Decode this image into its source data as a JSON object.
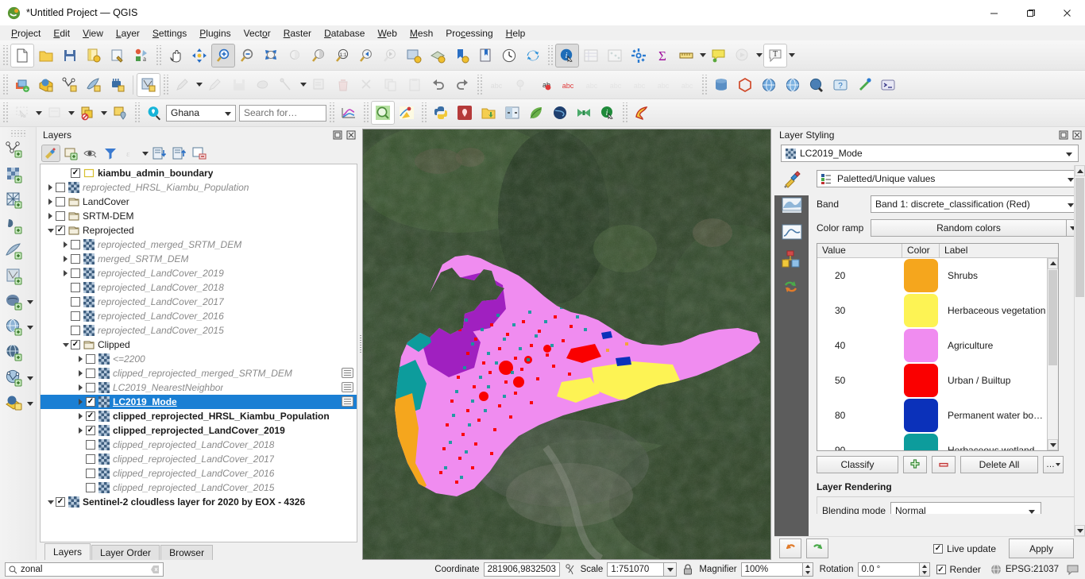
{
  "window": {
    "title": "*Untitled Project — QGIS",
    "app_icon": "qgis-logo-icon",
    "minimize": "—",
    "maximize": "❐",
    "close": "✕"
  },
  "menubar": {
    "items": [
      {
        "label": "Project",
        "mnemonic": "P"
      },
      {
        "label": "Edit",
        "mnemonic": "E"
      },
      {
        "label": "View",
        "mnemonic": "V"
      },
      {
        "label": "Layer",
        "mnemonic": "L"
      },
      {
        "label": "Settings",
        "mnemonic": "S"
      },
      {
        "label": "Plugins",
        "mnemonic": "P"
      },
      {
        "label": "Vector",
        "mnemonic": "o"
      },
      {
        "label": "Raster",
        "mnemonic": "R"
      },
      {
        "label": "Database",
        "mnemonic": "D"
      },
      {
        "label": "Web",
        "mnemonic": "W"
      },
      {
        "label": "Mesh",
        "mnemonic": "M"
      },
      {
        "label": "Processing",
        "mnemonic": "c"
      },
      {
        "label": "Help",
        "mnemonic": "H"
      }
    ]
  },
  "toolbars": {
    "project": [
      "new-project-icon",
      "open-project-icon",
      "save-project-icon",
      "save-project-as-icon",
      "new-print-layout-icon",
      "style-manager-icon"
    ],
    "navigation": [
      "pan-map-icon",
      "pan-to-selection-icon",
      "zoom-in-icon",
      "zoom-out-icon",
      "zoom-full-icon",
      "zoom-to-selection-icon",
      "zoom-to-layer-icon",
      "zoom-native-icon",
      "zoom-last-icon",
      "zoom-next-icon",
      "new-map-view-icon",
      "new-3d-map-view-icon",
      "bookmark-add-icon",
      "show-bookmarks-icon",
      "temporal-controller-icon",
      "refresh-icon"
    ],
    "attributes": [
      "identify-features-icon",
      "open-attribute-table-icon",
      "field-calculator-icon",
      "processing-toolbox-icon",
      "statistical-summary-icon",
      "measure-line-icon",
      "map-tips-icon",
      "run-feature-action-icon",
      "new-text-annotation-icon"
    ],
    "data_source": [
      "add-layer-icon",
      "add-wms-layer-icon",
      "add-vector-layer-icon",
      "add-delimited-text-layer-icon",
      "add-raster-layer-icon",
      "new-shapefile-layer-icon"
    ],
    "digitizing": [
      "current-edits-icon",
      "toggle-editing-icon",
      "save-layer-edits-icon",
      "add-polygon-feature-icon",
      "vertex-tool-icon",
      "modify-attributes-icon",
      "delete-selected-icon",
      "cut-features-icon",
      "copy-features-icon",
      "paste-features-icon",
      "undo-icon",
      "redo-icon"
    ],
    "labeling": [
      "label-icon",
      "pin-labels-icon",
      "highlight-labels-icon",
      "change-label-icon",
      "move-label-icon",
      "rotate-label-icon",
      "change-label-properties-icon",
      "show-hide-labels-icon",
      "show-unplaced-labels-icon"
    ],
    "database_web": [
      "db-manager-icon",
      "geopackage-icon",
      "metasearch-icon",
      "metasearch2-icon",
      "globe-icon",
      "help-icon",
      "plugin-manager-icon",
      "python-console-icon"
    ],
    "selection": [
      "select-features-icon",
      "deselect-icon",
      "select-by-expression-icon",
      "select-by-location-icon"
    ],
    "plugins": [
      "plugin-profile-tool-icon",
      "zoom-last-plugin-icon",
      "qgis2web-icon",
      "python-icon",
      "georeferencer-icon",
      "open-project-plugin-icon",
      "swipe-tool-icon",
      "leaflet-icon",
      "globe-plugin-icon",
      "bowtie-icon",
      "info-plugin-icon",
      "freehand-icon"
    ],
    "annotation": [
      "map-tip-icon",
      "annotation-layer-icon",
      "text-annotation-icon"
    ]
  },
  "project_selector": {
    "value": "Ghana",
    "search_placeholder": "Search for…"
  },
  "left_toolbar": {
    "items": [
      "add-vector-layer-icon",
      "add-raster-layer-icon",
      "add-mesh-layer-icon",
      "add-delimited-text-layer-icon",
      "add-spatialite-layer-icon",
      "add-vector-tile-layer-icon",
      "add-postgis-layer-icon",
      "add-wms-layer-icon",
      "add-wfs-layer-icon",
      "add-arcgis-layer-icon",
      "add-xyz-layer-icon"
    ]
  },
  "layers_panel": {
    "title": "Layers",
    "toolbar": [
      "open-layer-styling-icon",
      "add-group-icon",
      "manage-map-themes-icon",
      "filter-legend-icon",
      "filter-legend-expression-icon",
      "expand-all-icon",
      "collapse-all-icon",
      "remove-layer-icon"
    ],
    "tabs": [
      {
        "label": "Layers",
        "active": true
      },
      {
        "label": "Layer Order",
        "active": false
      },
      {
        "label": "Browser",
        "active": false
      }
    ],
    "tree": [
      {
        "label": "kiambu_admin_boundary",
        "indent": 1,
        "checked": true,
        "expander": "none",
        "icon": "polygon-layer-icon",
        "style": "bold",
        "selected": false,
        "chip": false
      },
      {
        "label": "reprojected_HRSL_Kiambu_Population",
        "indent": 0,
        "checked": false,
        "expander": "right",
        "icon": "raster-layer-icon",
        "style": "italic-grey",
        "selected": false,
        "chip": false
      },
      {
        "label": "LandCover",
        "indent": 0,
        "checked": false,
        "expander": "right",
        "icon": "group-icon",
        "style": "normal",
        "selected": false,
        "chip": false
      },
      {
        "label": "SRTM-DEM",
        "indent": 0,
        "checked": false,
        "expander": "right",
        "icon": "group-icon",
        "style": "normal",
        "selected": false,
        "chip": false
      },
      {
        "label": "Reprojected",
        "indent": 0,
        "checked": true,
        "expander": "down",
        "icon": "group-icon",
        "style": "normal",
        "selected": false,
        "chip": false
      },
      {
        "label": "reprojected_merged_SRTM_DEM",
        "indent": 1,
        "checked": false,
        "expander": "right",
        "icon": "raster-layer-icon",
        "style": "italic-grey",
        "selected": false,
        "chip": false
      },
      {
        "label": "merged_SRTM_DEM",
        "indent": 1,
        "checked": false,
        "expander": "right",
        "icon": "raster-layer-icon",
        "style": "italic-grey",
        "selected": false,
        "chip": false
      },
      {
        "label": "reprojected_LandCover_2019",
        "indent": 1,
        "checked": false,
        "expander": "right",
        "icon": "raster-layer-icon",
        "style": "italic-grey",
        "selected": false,
        "chip": false
      },
      {
        "label": "reprojected_LandCover_2018",
        "indent": 1,
        "checked": false,
        "expander": "none",
        "icon": "raster-layer-icon",
        "style": "italic-grey",
        "selected": false,
        "chip": false
      },
      {
        "label": "reprojected_LandCover_2017",
        "indent": 1,
        "checked": false,
        "expander": "none",
        "icon": "raster-layer-icon",
        "style": "italic-grey",
        "selected": false,
        "chip": false
      },
      {
        "label": "reprojected_LandCover_2016",
        "indent": 1,
        "checked": false,
        "expander": "none",
        "icon": "raster-layer-icon",
        "style": "italic-grey",
        "selected": false,
        "chip": false
      },
      {
        "label": "reprojected_LandCover_2015",
        "indent": 1,
        "checked": false,
        "expander": "none",
        "icon": "raster-layer-icon",
        "style": "italic-grey",
        "selected": false,
        "chip": false
      },
      {
        "label": "Clipped",
        "indent": 1,
        "checked": true,
        "expander": "down",
        "icon": "group-icon",
        "style": "normal",
        "selected": false,
        "chip": false
      },
      {
        "label": "<=2200",
        "indent": 2,
        "checked": false,
        "expander": "right",
        "icon": "raster-layer-icon",
        "style": "italic-grey",
        "selected": false,
        "chip": false
      },
      {
        "label": "clipped_reprojected_merged_SRTM_DEM",
        "indent": 2,
        "checked": false,
        "expander": "right",
        "icon": "raster-layer-icon",
        "style": "italic-grey",
        "selected": false,
        "chip": true
      },
      {
        "label": "LC2019_NearestNeighbor",
        "indent": 2,
        "checked": false,
        "expander": "right",
        "icon": "raster-layer-icon",
        "style": "italic-grey",
        "selected": false,
        "chip": true
      },
      {
        "label": "LC2019_Mode",
        "indent": 2,
        "checked": true,
        "expander": "right",
        "icon": "raster-layer-icon",
        "style": "selected",
        "selected": true,
        "chip": true
      },
      {
        "label": "clipped_reprojected_HRSL_Kiambu_Population",
        "indent": 2,
        "checked": true,
        "expander": "right",
        "icon": "raster-layer-icon",
        "style": "bold",
        "selected": false,
        "chip": false
      },
      {
        "label": "clipped_reprojected_LandCover_2019",
        "indent": 2,
        "checked": true,
        "expander": "right",
        "icon": "raster-layer-icon",
        "style": "bold",
        "selected": false,
        "chip": false
      },
      {
        "label": "clipped_reprojected_LandCover_2018",
        "indent": 2,
        "checked": false,
        "expander": "none",
        "icon": "raster-layer-icon",
        "style": "italic-grey",
        "selected": false,
        "chip": false
      },
      {
        "label": "clipped_reprojected_LandCover_2017",
        "indent": 2,
        "checked": false,
        "expander": "none",
        "icon": "raster-layer-icon",
        "style": "italic-grey",
        "selected": false,
        "chip": false
      },
      {
        "label": "clipped_reprojected_LandCover_2016",
        "indent": 2,
        "checked": false,
        "expander": "none",
        "icon": "raster-layer-icon",
        "style": "italic-grey",
        "selected": false,
        "chip": false
      },
      {
        "label": "clipped_reprojected_LandCover_2015",
        "indent": 2,
        "checked": false,
        "expander": "none",
        "icon": "raster-layer-icon",
        "style": "italic-grey",
        "selected": false,
        "chip": false
      },
      {
        "label": "Sentinel-2 cloudless layer for 2020 by EOX - 4326",
        "indent": 0,
        "checked": true,
        "expander": "down",
        "icon": "raster-layer-icon",
        "style": "bold",
        "selected": false,
        "chip": false
      }
    ]
  },
  "style_panel": {
    "title": "Layer Styling",
    "layer_selector": "LC2019_Mode",
    "renderer": "Paletted/Unique values",
    "band_label": "Band",
    "band_value": "Band 1: discrete_classification (Red)",
    "ramp_label": "Color ramp",
    "ramp_value": "Random colors",
    "side_icons": [
      "paintbrush-icon",
      "histogram-icon",
      "transparency-icon",
      "pyramids-icon",
      "undo-redo-icon"
    ],
    "table": {
      "headers": [
        "Value",
        "Color",
        "Label"
      ],
      "rows": [
        {
          "value": "20",
          "color": "#f5a61d",
          "label": "Shrubs"
        },
        {
          "value": "30",
          "color": "#fdf354",
          "label": "Herbaceous vegetation"
        },
        {
          "value": "40",
          "color": "#f08cf0",
          "label": "Agriculture"
        },
        {
          "value": "50",
          "color": "#fa0000",
          "label": "Urban / Builtup"
        },
        {
          "value": "80",
          "color": "#0b31ba",
          "label": "Permanent water bo…"
        },
        {
          "value": "90",
          "color": "#0d9c9c",
          "label": "Herbaceous wetland"
        }
      ]
    },
    "buttons": {
      "classify": "Classify",
      "add": "add-entry-icon",
      "remove": "delete-entry-icon",
      "delete_all": "Delete All",
      "more": "…"
    },
    "layer_rendering_title": "Layer Rendering",
    "blending_label": "Blending mode",
    "blending_value": "Normal",
    "footer": {
      "undo": "undo-icon",
      "redo": "redo-icon",
      "live_update_label": "Live update",
      "live_update_checked": true,
      "apply_label": "Apply"
    }
  },
  "statusbar": {
    "locator_value": "zonal",
    "locator_icon": "search-icon",
    "locator_clear": "clear-icon",
    "coordinate_label": "Coordinate",
    "coordinate_value": "281906,9832503",
    "coordinate_toggle_icon": "toggle-extents-icon",
    "scale_label": "Scale",
    "scale_value": "1:751070",
    "lock_icon": "lock-scale-icon",
    "magnifier_label": "Magnifier",
    "magnifier_value": "100%",
    "rotation_label": "Rotation",
    "rotation_value": "0.0 °",
    "render_label": "Render",
    "render_checked": true,
    "crs_label": "EPSG:21037",
    "crs_icon": "crs-globe-icon",
    "messages_icon": "messages-icon"
  },
  "map": {
    "basemap_name": "Sentinel-2 cloudless 2020",
    "classes": {
      "agriculture": "#f08cf0",
      "urban": "#fa0000",
      "shrubs": "#f5a61d",
      "herbaceous_vegetation": "#fdf354",
      "water": "#0b31ba",
      "wetland": "#0d9c9c",
      "forest": "#a020c0"
    }
  }
}
